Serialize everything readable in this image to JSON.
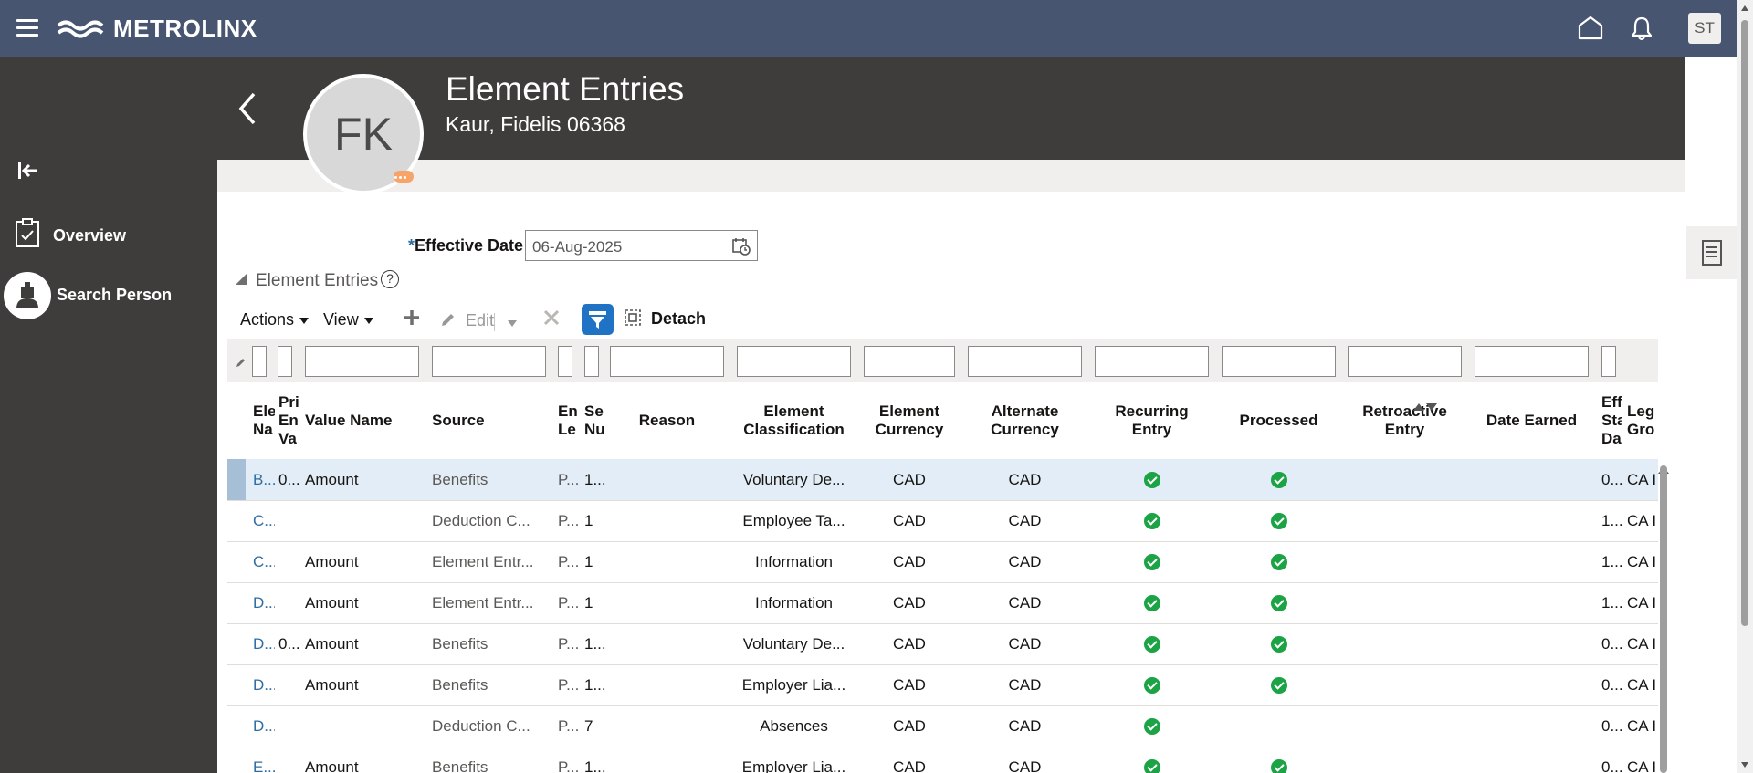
{
  "topbar": {
    "brand": "METROLINX",
    "user_initials": "ST",
    "icons": [
      "menu-icon",
      "home-icon",
      "bell-icon"
    ]
  },
  "sidebar": {
    "items": [
      {
        "label": "Overview",
        "icon": "clipboard-check-icon"
      },
      {
        "label": "Search Person",
        "icon": "person-icon"
      }
    ]
  },
  "header": {
    "title": "Element Entries",
    "subtitle": "Kaur, Fidelis 06368",
    "avatar_initials": "FK"
  },
  "effective_date": {
    "label": "Effective Date",
    "required_mark": "*",
    "value": "06-Aug-2025"
  },
  "section": {
    "title": "Element Entries",
    "help": "?"
  },
  "toolbar": {
    "actions_label": "Actions",
    "view_label": "View",
    "edit_label": "Edit",
    "detach_label": "Detach"
  },
  "columns": {
    "element_name": [
      "Ele",
      "Na"
    ],
    "primary": [
      "Pri",
      "En",
      "Va"
    ],
    "value_name": "Value Name",
    "source": "Source",
    "entry_level": [
      "En",
      "Le"
    ],
    "sequence": [
      "Se",
      "Nu"
    ],
    "reason": "Reason",
    "classification": [
      "Element",
      "Classification"
    ],
    "element_currency": [
      "Element",
      "Currency"
    ],
    "alternate_currency": [
      "Alternate",
      "Currency"
    ],
    "recurring": [
      "Recurring",
      "Entry"
    ],
    "processed": "Processed",
    "retroactive": [
      "Retroactive",
      "Entry"
    ],
    "date_earned": "Date Earned",
    "eff_start": [
      "Eff",
      "Sta",
      "Da"
    ],
    "legislative": [
      "Leg",
      "Gro"
    ]
  },
  "rows": [
    {
      "name": "B...",
      "primary": "0...",
      "value_name": "Amount",
      "source": "Benefits",
      "level": "P...",
      "seq": "1...",
      "classification": "Voluntary De...",
      "cur": "CAD",
      "alt": "CAD",
      "recurring": true,
      "processed": true,
      "eff": "0...",
      "leg": "CA I"
    },
    {
      "name": "C...",
      "primary": "",
      "value_name": "",
      "source": "Deduction C...",
      "level": "P...",
      "seq": "1",
      "classification": "Employee Ta...",
      "cur": "CAD",
      "alt": "CAD",
      "recurring": true,
      "processed": true,
      "eff": "1...",
      "leg": "CA I"
    },
    {
      "name": "C...",
      "primary": "",
      "value_name": "Amount",
      "source": "Element Entr...",
      "level": "P...",
      "seq": "1",
      "classification": "Information",
      "cur": "CAD",
      "alt": "CAD",
      "recurring": true,
      "processed": true,
      "eff": "1...",
      "leg": "CA I"
    },
    {
      "name": "D...",
      "primary": "",
      "value_name": "Amount",
      "source": "Element Entr...",
      "level": "P...",
      "seq": "1",
      "classification": "Information",
      "cur": "CAD",
      "alt": "CAD",
      "recurring": true,
      "processed": true,
      "eff": "1...",
      "leg": "CA I"
    },
    {
      "name": "D...",
      "primary": "0...",
      "value_name": "Amount",
      "source": "Benefits",
      "level": "P...",
      "seq": "1...",
      "classification": "Voluntary De...",
      "cur": "CAD",
      "alt": "CAD",
      "recurring": true,
      "processed": true,
      "eff": "0...",
      "leg": "CA I"
    },
    {
      "name": "D...",
      "primary": "",
      "value_name": "Amount",
      "source": "Benefits",
      "level": "P...",
      "seq": "1...",
      "classification": "Employer Lia...",
      "cur": "CAD",
      "alt": "CAD",
      "recurring": true,
      "processed": true,
      "eff": "0...",
      "leg": "CA I"
    },
    {
      "name": "D...",
      "primary": "",
      "value_name": "",
      "source": "Deduction C...",
      "level": "P...",
      "seq": "7",
      "classification": "Absences",
      "cur": "CAD",
      "alt": "CAD",
      "recurring": true,
      "processed": false,
      "eff": "0...",
      "leg": "CA I"
    },
    {
      "name": "E...",
      "primary": "",
      "value_name": "Amount",
      "source": "Benefits",
      "level": "P...",
      "seq": "1...",
      "classification": "Employer Lia...",
      "cur": "CAD",
      "alt": "CAD",
      "recurring": true,
      "processed": true,
      "eff": "0...",
      "leg": "CA I"
    }
  ],
  "colors": {
    "topbar": "#475570",
    "sidebar": "#3e3d3b",
    "link": "#2d6da3",
    "check": "#1ba345",
    "selected_row": "#e3edf7"
  }
}
